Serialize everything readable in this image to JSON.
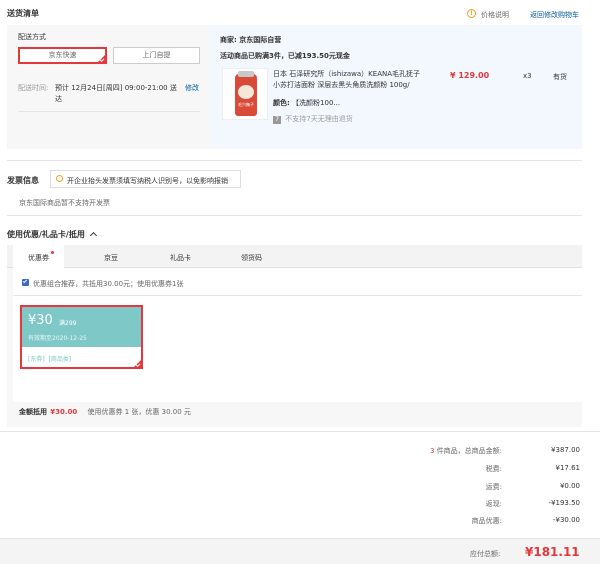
{
  "header": {
    "title": "送货清单",
    "price_note": "价格说明",
    "back_to_cart": "返回修改购物车"
  },
  "delivery": {
    "heading": "配送方式",
    "option_express": "京东快速",
    "option_pickup": "上门自提",
    "time_label": "配送时间:",
    "time_value": "预计 12月24日[周四] 09:00-21:00 送达",
    "modify": "修改"
  },
  "merchant": {
    "label": "商家:",
    "name": "京东国际自营",
    "promo": "活动商品已购满3件，已减193.50元现金"
  },
  "product": {
    "name": "日本 石泽研究所（ishizawa）KEANA毛孔抚子小苏打洁面粉 深层去黑头角质洗颜粉 100g/",
    "color_label": "颜色:",
    "color_value": "【洗颜粉100...",
    "return_policy": "不支持7天无理由退货",
    "return_icon": "7",
    "price": "¥ 129.00",
    "qty": "x3",
    "stock": "有货",
    "image_text": "毛穴撫子"
  },
  "invoice": {
    "title": "发票信息",
    "tip": "开企业抬头发票须填写纳税人识别号，以免影响报销",
    "note": "京东国际商品暂不支持开发票"
  },
  "coupons": {
    "title": "使用优惠/礼品卡/抵用",
    "tabs": [
      "优惠券",
      "京豆",
      "礼品卡",
      "领货码"
    ],
    "recommend": "优惠组合推荐，共抵用30.00元；使用优惠券1张",
    "coupon_amount": "¥30",
    "coupon_condition": "满299",
    "coupon_expire": "有效期至2020-12-25",
    "coupon_tags": "[东券]  [商品类]",
    "deduct_label": "金额抵用",
    "deduct_amount": "¥30.00",
    "deduct_desc": "使用优惠券 1 张，优惠 30.00 元"
  },
  "summary": {
    "count": "3",
    "count_suffix": "件商品，总商品金额:",
    "total_goods": "¥387.00",
    "tax_label": "税费:",
    "tax": "¥17.61",
    "shipping_label": "运费:",
    "shipping": "¥0.00",
    "rebate_label": "返现:",
    "rebate": "-¥193.50",
    "discount_label": "商品优惠:",
    "discount": "-¥30.00",
    "payable_label": "应付总额:",
    "payable": "¥181.11"
  }
}
